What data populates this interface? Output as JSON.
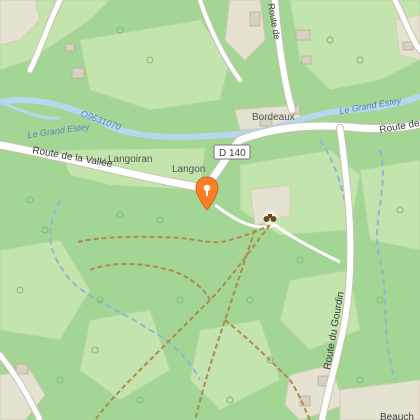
{
  "map": {
    "roads": {
      "route_de_la_vallee": "Route de la Vallée",
      "d140": "D 140",
      "route_du_gourdin": "Route du Gourdin",
      "route_de_top_left": "Route de",
      "route_de_right": "Route de L"
    },
    "waterways": {
      "le_grand_estey_left": "Le Grand Estey",
      "le_grand_estey_right": "Le Grand Estey",
      "code": "O9631070"
    },
    "places": {
      "langoiran": "Langoiran",
      "langon": "Langon",
      "bordeaux": "Bordeaux",
      "beauch": "Beauch"
    },
    "markers": {
      "pin_icon": "location-pin-icon",
      "viewpoint_icon": "binoculars-icon"
    },
    "colors": {
      "forest": "#a3d594",
      "field": "#c7e5b2",
      "road": "#ffffff",
      "stream": "#b6d7ee",
      "path": "#b08a4a",
      "pin": "#ff7f27"
    }
  }
}
